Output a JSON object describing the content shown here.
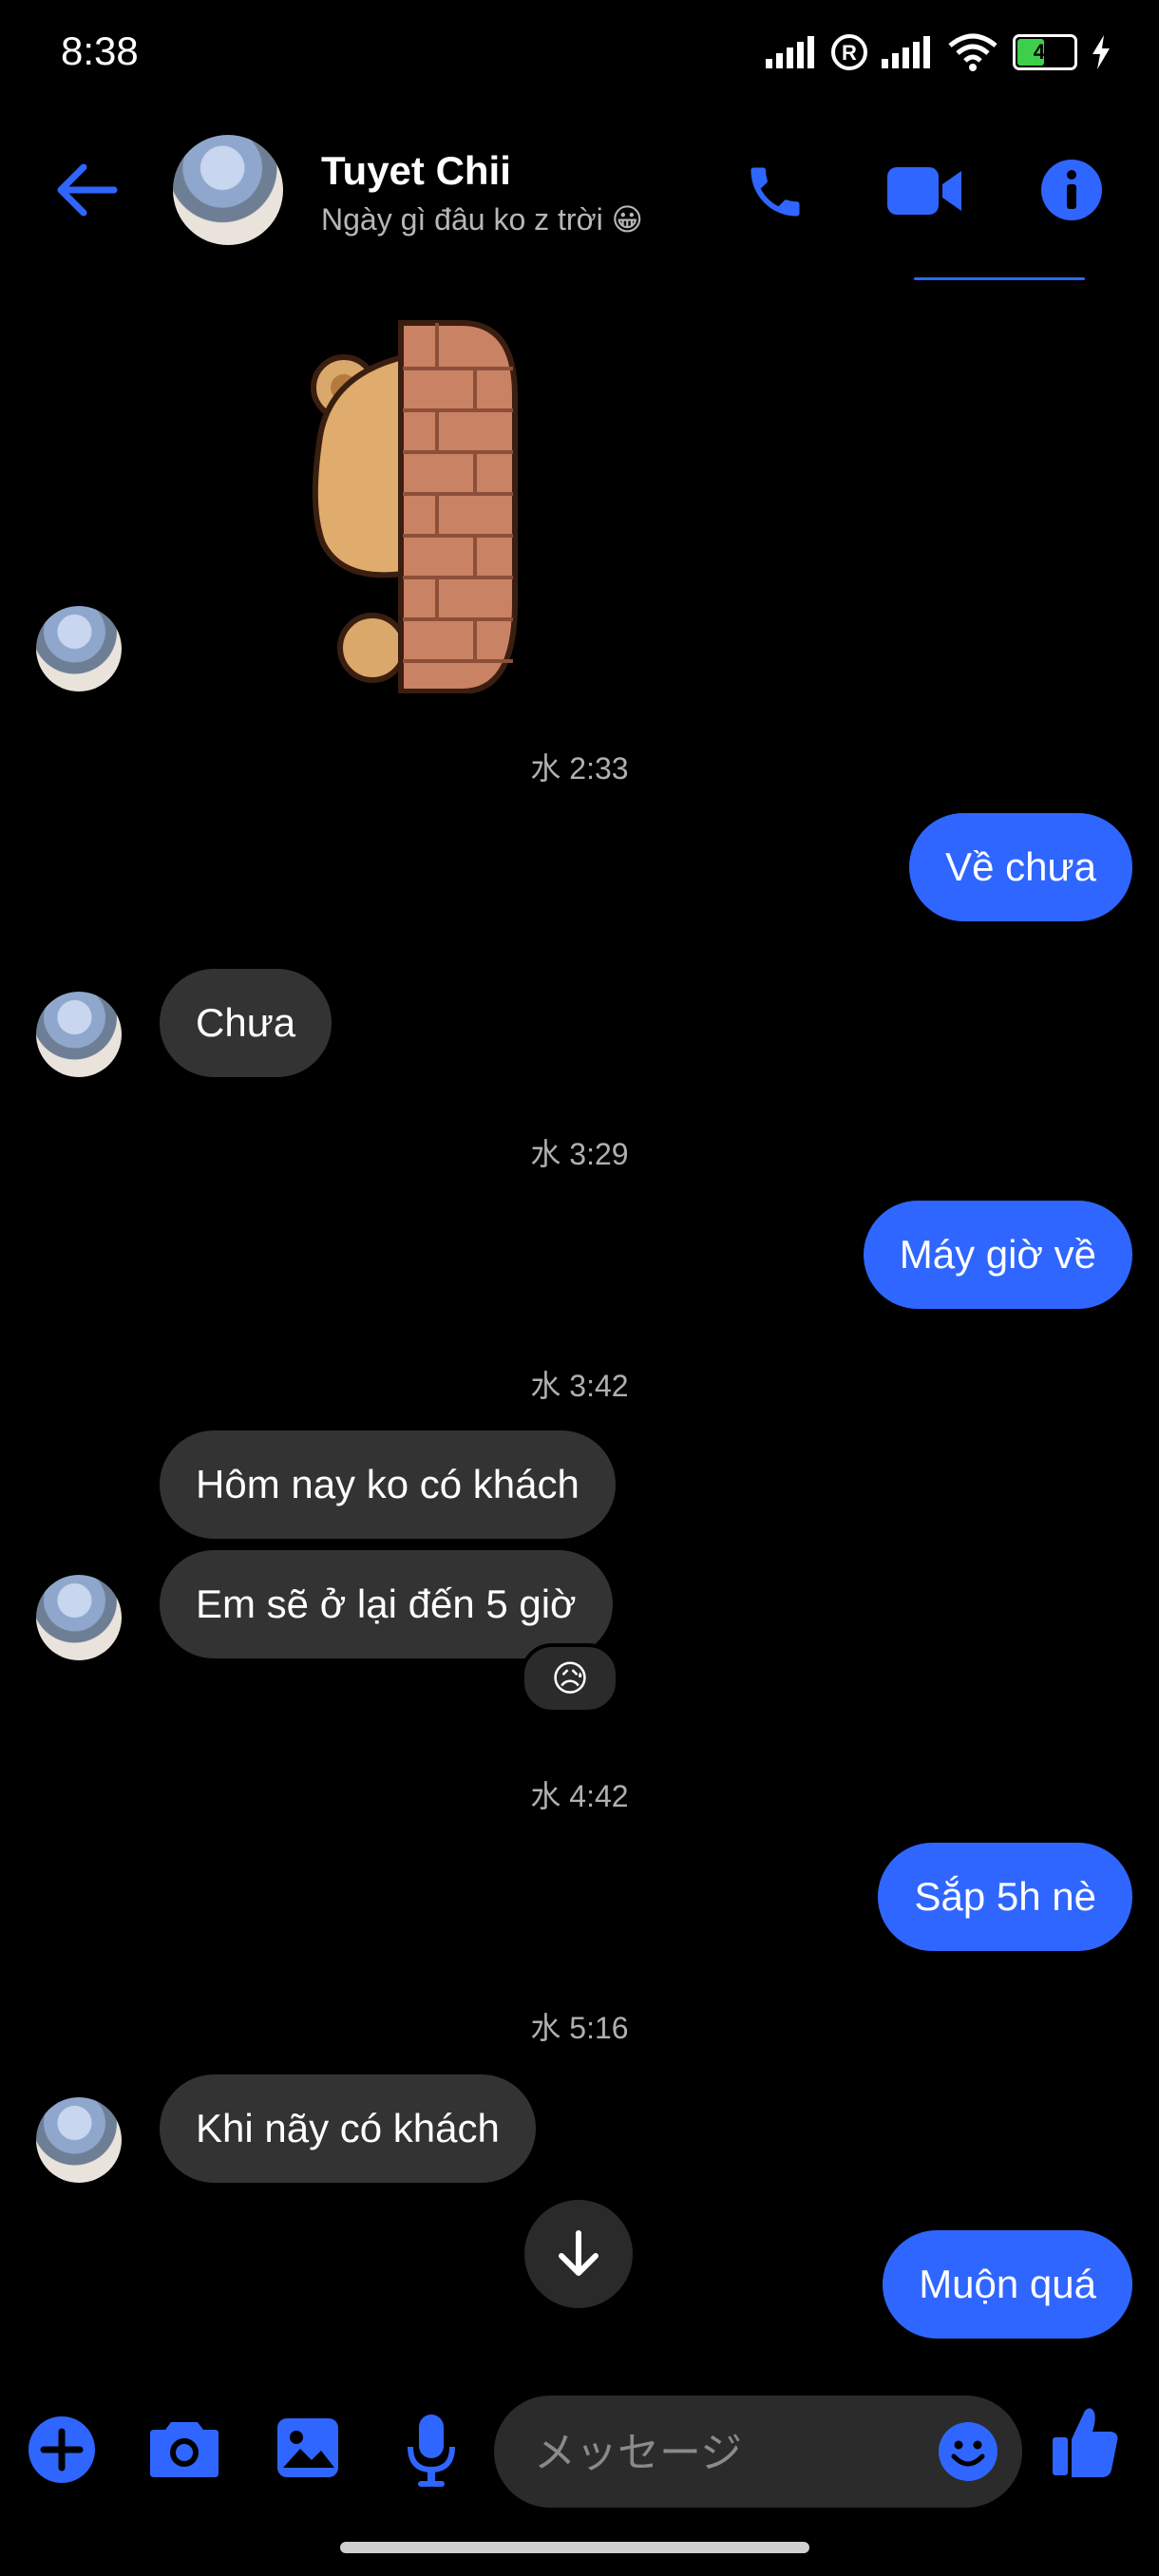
{
  "status_bar": {
    "time": "8:38",
    "battery": "45"
  },
  "header": {
    "contact_name": "Tuyet Chii",
    "contact_status": "Ngày gì đâu ko z trời 😀",
    "icons": [
      "back-arrow-icon",
      "phone-icon",
      "video-camera-icon",
      "info-icon"
    ]
  },
  "messages": [
    {
      "type": "sticker",
      "from": "them",
      "name": "bear-peeking-behind-wall-sticker"
    },
    {
      "type": "timestamp",
      "text": "水 2:33"
    },
    {
      "type": "text",
      "from": "me",
      "text": "Về chưa"
    },
    {
      "type": "text",
      "from": "them",
      "text": "Chưa"
    },
    {
      "type": "timestamp",
      "text": "水 3:29"
    },
    {
      "type": "text",
      "from": "me",
      "text": "Máy giờ về"
    },
    {
      "type": "timestamp",
      "text": "水 3:42"
    },
    {
      "type": "text",
      "from": "them",
      "text": "Hôm nay ko có khách"
    },
    {
      "type": "text",
      "from": "them",
      "text": "Em sẽ ở lại đến 5 giờ",
      "reaction": "😥"
    },
    {
      "type": "timestamp",
      "text": "水 4:42"
    },
    {
      "type": "text",
      "from": "me",
      "text": "Sắp 5h nè"
    },
    {
      "type": "timestamp",
      "text": "水 5:16"
    },
    {
      "type": "text",
      "from": "them",
      "text": "Khi nãy có khách"
    },
    {
      "type": "text",
      "from": "me",
      "text": "Muộn quá"
    }
  ],
  "composer": {
    "placeholder": "メッセージ",
    "icons": [
      "plus-icon",
      "camera-icon",
      "gallery-icon",
      "microphone-icon",
      "emoji-icon",
      "thumbs-up-icon"
    ]
  },
  "colors": {
    "accent": "#2f66ff",
    "incoming_bubble": "#333333",
    "background": "#000000"
  }
}
